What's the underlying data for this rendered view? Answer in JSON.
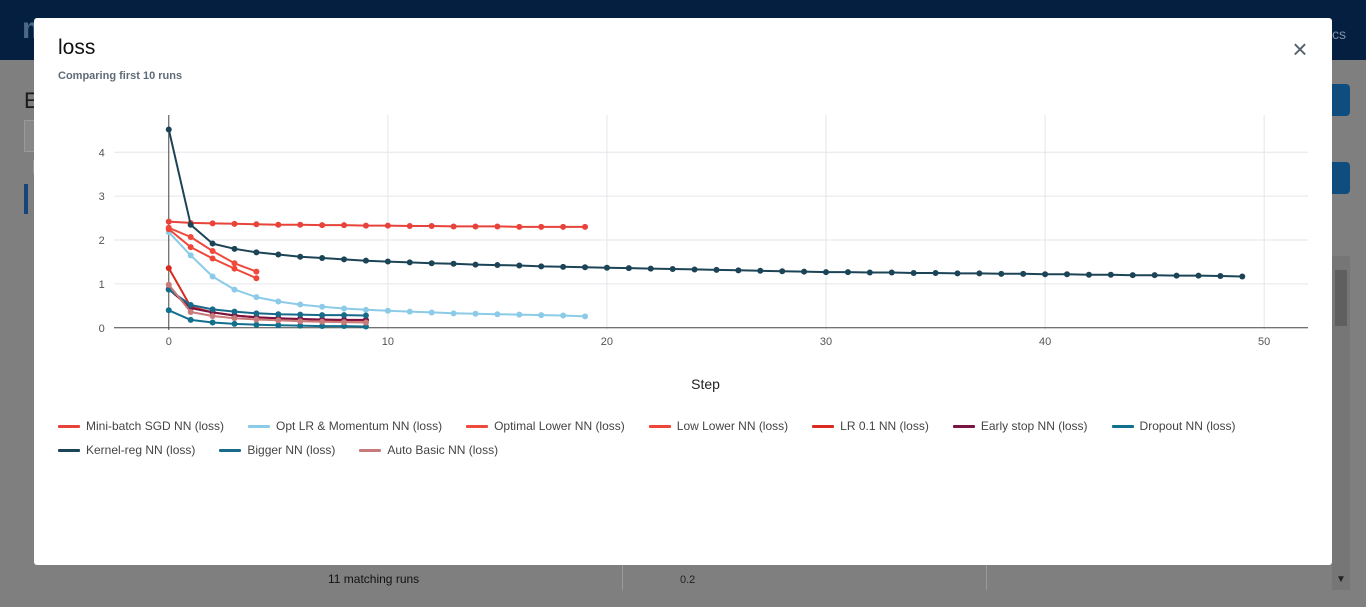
{
  "background": {
    "logo_text": "m",
    "nav_right_text": "cs",
    "page_title_partial": "E",
    "matching_runs": "11 matching runs",
    "mini_axis_label": "0.2"
  },
  "modal": {
    "title": "loss",
    "subtitle": "Comparing first 10 runs",
    "close_symbol": "×"
  },
  "chart_data": {
    "type": "line",
    "title": "",
    "xlabel": "Step",
    "ylabel": "",
    "xlim": [
      -2.5,
      52
    ],
    "ylim": [
      -0.05,
      4.85
    ],
    "xticks": [
      0,
      10,
      20,
      30,
      40,
      50
    ],
    "yticks": [
      0,
      1,
      2,
      3,
      4
    ],
    "grid": true,
    "legend_position": "bottom",
    "series": [
      {
        "name": "Mini-batch SGD NN (loss)",
        "color": "#e8433a",
        "x": [
          0,
          1,
          2,
          3,
          4,
          5,
          6,
          7,
          8,
          9,
          10,
          11,
          12,
          13,
          14,
          15,
          16,
          17,
          18,
          19
        ],
        "y": [
          2.42,
          2.39,
          2.38,
          2.37,
          2.36,
          2.35,
          2.35,
          2.34,
          2.34,
          2.33,
          2.33,
          2.32,
          2.32,
          2.31,
          2.31,
          2.31,
          2.3,
          2.3,
          2.3,
          2.3
        ]
      },
      {
        "name": "Opt LR & Momentum NN (loss)",
        "color": "#8ccbe8",
        "x": [
          0,
          1,
          2,
          3,
          4,
          5,
          6,
          7,
          8,
          9,
          10,
          11,
          12,
          13,
          14,
          15,
          16,
          17,
          18,
          19
        ],
        "y": [
          2.18,
          1.65,
          1.17,
          0.87,
          0.7,
          0.6,
          0.53,
          0.48,
          0.44,
          0.41,
          0.39,
          0.37,
          0.35,
          0.33,
          0.32,
          0.31,
          0.3,
          0.29,
          0.28,
          0.26
        ]
      },
      {
        "name": "Optimal Lower NN (loss)",
        "color": "#ee4a3e",
        "x": [
          0,
          1,
          2,
          3,
          4
        ],
        "y": [
          2.28,
          2.07,
          1.75,
          1.47,
          1.28
        ]
      },
      {
        "name": "Low Lower NN (loss)",
        "color": "#ef4638",
        "x": [
          0,
          1,
          2,
          3,
          4
        ],
        "y": [
          2.25,
          1.84,
          1.58,
          1.35,
          1.13
        ]
      },
      {
        "name": "LR 0.1 NN (loss)",
        "color": "#d92b1f",
        "x": [
          0,
          1,
          2,
          3,
          4,
          5,
          6,
          7,
          8,
          9
        ],
        "y": [
          1.36,
          0.48,
          0.35,
          0.28,
          0.24,
          0.21,
          0.2,
          0.18,
          0.17,
          0.17
        ]
      },
      {
        "name": "Early stop NN (loss)",
        "color": "#7a1440",
        "x": [
          0,
          1,
          2,
          3,
          4,
          5,
          6,
          7,
          8,
          9
        ],
        "y": [
          0.88,
          0.45,
          0.35,
          0.28,
          0.24,
          0.22,
          0.2,
          0.19,
          0.18,
          0.18
        ]
      },
      {
        "name": "Dropout NN (loss)",
        "color": "#12708f",
        "x": [
          0,
          1,
          2,
          3,
          4,
          5,
          6,
          7,
          8,
          9
        ],
        "y": [
          0.4,
          0.18,
          0.12,
          0.09,
          0.07,
          0.06,
          0.05,
          0.04,
          0.04,
          0.03
        ]
      },
      {
        "name": "Kernel-reg NN (loss)",
        "color": "#1b4456",
        "x": [
          0,
          1,
          2,
          3,
          4,
          5,
          6,
          7,
          8,
          9,
          10,
          11,
          12,
          13,
          14,
          15,
          16,
          17,
          18,
          19,
          20,
          21,
          22,
          23,
          24,
          25,
          26,
          27,
          28,
          29,
          30,
          31,
          32,
          33,
          34,
          35,
          36,
          37,
          38,
          39,
          40,
          41,
          42,
          43,
          44,
          45,
          46,
          47,
          48,
          49
        ],
        "y": [
          4.52,
          2.35,
          1.92,
          1.8,
          1.72,
          1.67,
          1.62,
          1.59,
          1.56,
          1.53,
          1.51,
          1.49,
          1.47,
          1.46,
          1.44,
          1.43,
          1.42,
          1.4,
          1.39,
          1.38,
          1.37,
          1.36,
          1.35,
          1.34,
          1.33,
          1.32,
          1.31,
          1.3,
          1.29,
          1.28,
          1.27,
          1.27,
          1.26,
          1.26,
          1.25,
          1.25,
          1.24,
          1.24,
          1.23,
          1.23,
          1.22,
          1.22,
          1.21,
          1.21,
          1.2,
          1.2,
          1.19,
          1.19,
          1.18,
          1.17
        ]
      },
      {
        "name": "Bigger NN (loss)",
        "color": "#176a8a",
        "x": [
          0,
          1,
          2,
          3,
          4,
          5,
          6,
          7,
          8,
          9
        ],
        "y": [
          0.87,
          0.52,
          0.42,
          0.37,
          0.33,
          0.31,
          0.3,
          0.29,
          0.29,
          0.28
        ]
      },
      {
        "name": "Auto Basic NN (loss)",
        "color": "#c97a7a",
        "x": [
          0,
          1,
          2,
          3,
          4,
          5,
          6,
          7,
          8,
          9
        ],
        "y": [
          0.98,
          0.36,
          0.27,
          0.22,
          0.19,
          0.17,
          0.15,
          0.14,
          0.13,
          0.12
        ]
      }
    ]
  }
}
